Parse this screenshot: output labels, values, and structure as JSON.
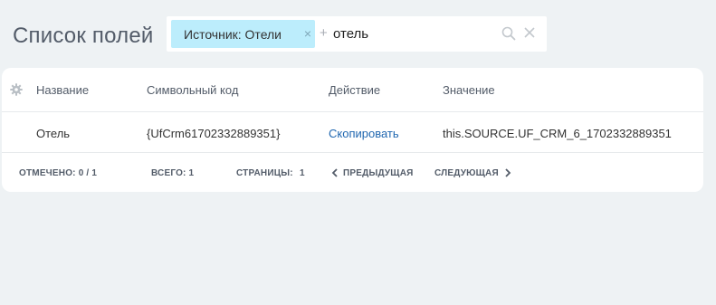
{
  "page": {
    "title": "Список полей"
  },
  "filter": {
    "chip_label": "Источник: Отели",
    "chip_close": "×",
    "plus": "+",
    "query": "отель"
  },
  "grid": {
    "columns": [
      "Название",
      "Символьный код",
      "Действие",
      "Значение"
    ],
    "rows": [
      {
        "name": "Отель",
        "code": "{UfCrm61702332889351}",
        "action": "Скопировать",
        "value": "this.SOURCE.UF_CRM_6_1702332889351"
      }
    ],
    "footer": {
      "selected": "ОТМЕЧЕНО: 0 / 1",
      "total": "ВСЕГО: 1",
      "pages_label": "СТРАНИЦЫ:",
      "pages_value": "1",
      "prev": "ПРЕДЫДУЩАЯ",
      "next": "СЛЕДУЮЩАЯ"
    }
  },
  "colors": {
    "background": "#eef2f4",
    "chip": "#bcedfc",
    "link": "#2067b0"
  },
  "icons": [
    "search-icon",
    "clear-icon",
    "gear-icon",
    "chevron-left-icon",
    "chevron-right-icon"
  ]
}
